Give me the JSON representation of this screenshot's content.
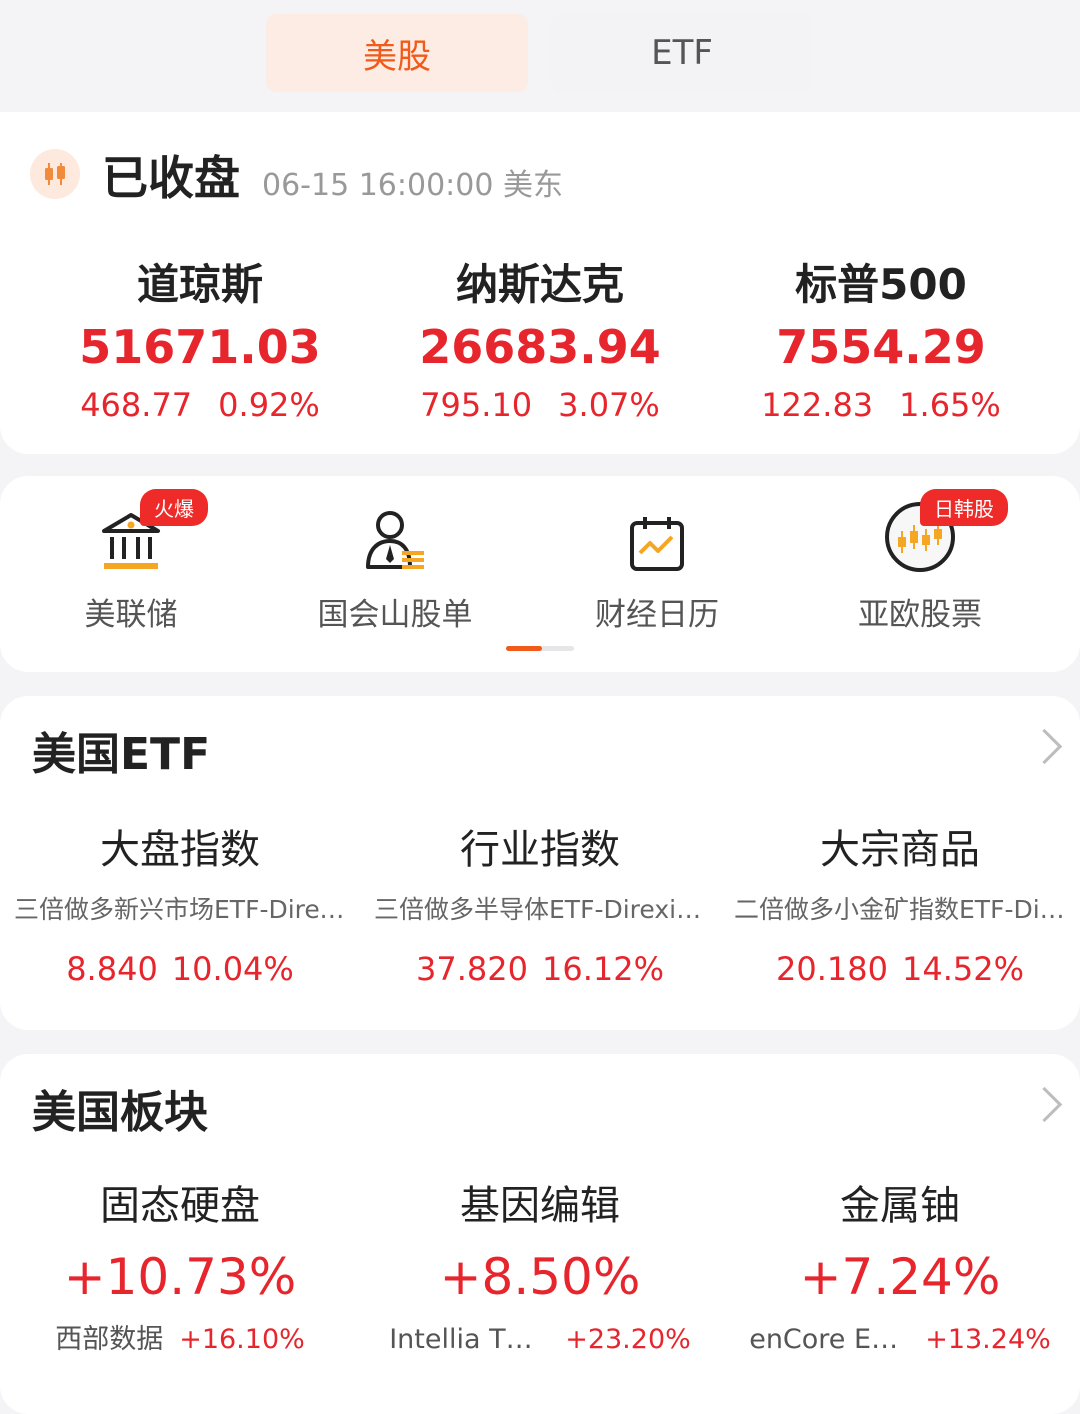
{
  "tabs": [
    {
      "label": "美股",
      "active": true
    },
    {
      "label": "ETF",
      "active": false
    }
  ],
  "market_status": {
    "title": "已收盘",
    "time": "06-15 16:00:00 美东"
  },
  "indices": [
    {
      "name": "道琼斯",
      "value": "51671.03",
      "change": "468.77",
      "change_pct": "0.92%"
    },
    {
      "name": "纳斯达克",
      "value": "26683.94",
      "change": "795.10",
      "change_pct": "3.07%"
    },
    {
      "name": "标普500",
      "value": "7554.29",
      "change": "122.83",
      "change_pct": "1.65%"
    }
  ],
  "shortcuts": [
    {
      "label": "美联储",
      "badge": "火爆",
      "icon": "bank-icon"
    },
    {
      "label": "国会山股单",
      "badge": "",
      "icon": "person-list-icon"
    },
    {
      "label": "财经日历",
      "badge": "",
      "icon": "calendar-chart-icon"
    },
    {
      "label": "亚欧股票",
      "badge": "日韩股",
      "icon": "globe-candles-icon"
    }
  ],
  "us_etf": {
    "title": "美国ETF",
    "items": [
      {
        "category": "大盘指数",
        "name": "三倍做多新兴市场ETF-Direxion",
        "price": "8.840",
        "pct": "10.04%"
      },
      {
        "category": "行业指数",
        "name": "三倍做多半导体ETF-Direxion",
        "price": "37.820",
        "pct": "16.12%"
      },
      {
        "category": "大宗商品",
        "name": "二倍做多小金矿指数ETF-Direxion",
        "price": "20.180",
        "pct": "14.52%"
      }
    ]
  },
  "us_sectors": {
    "title": "美国板块",
    "items": [
      {
        "name": "固态硬盘",
        "pct": "+10.73%",
        "leader": "西部数据",
        "leader_pct": "+16.10%"
      },
      {
        "name": "基因编辑",
        "pct": "+8.50%",
        "leader": "Intellia Therapeutics",
        "leader_pct": "+23.20%"
      },
      {
        "name": "金属铀",
        "pct": "+7.24%",
        "leader": "enCore Energy",
        "leader_pct": "+13.24%"
      }
    ]
  },
  "colors": {
    "accent": "#f05a1a",
    "up": "#e6252c",
    "badge": "#ee2b28"
  }
}
